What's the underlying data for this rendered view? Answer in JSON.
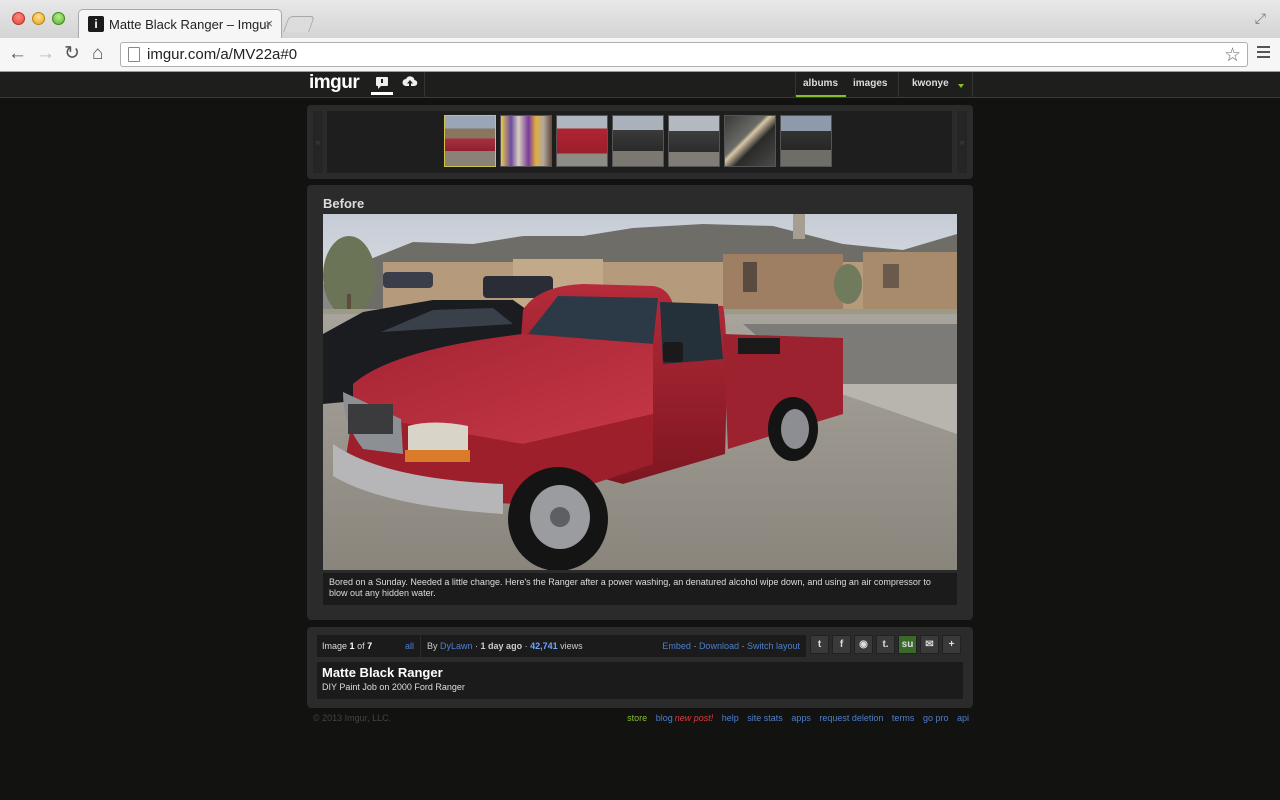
{
  "browser": {
    "tab_title": "Matte Black Ranger – Imgur",
    "tab_close": "×",
    "url": "imgur.com/a/MV22a#0",
    "back": "←",
    "forward": "→",
    "reload": "↻",
    "home": "⌂",
    "star": "☆",
    "fullscreen": "⤢"
  },
  "header": {
    "logo": "imgur",
    "nav": [
      "albums",
      "images"
    ],
    "user": "kwonye",
    "active_nav": "albums",
    "accent_color": "#85bf25"
  },
  "album": {
    "thumbnails": [
      {
        "subject": "red truck in driveway",
        "selected": true
      },
      {
        "subject": "cans of paint and supplies",
        "selected": false
      },
      {
        "subject": "red truck masked",
        "selected": false
      },
      {
        "subject": "black truck front",
        "selected": false
      },
      {
        "subject": "black truck angle",
        "selected": false
      },
      {
        "subject": "black panel close-up",
        "selected": false
      },
      {
        "subject": "black truck finished",
        "selected": false
      }
    ],
    "current_image": {
      "title": "Before",
      "caption": "Bored on a Sunday. Needed a little change. Here's the Ranger after a power washing, an denatured alcohol wipe down, and using an air compressor to blow out any hidden water."
    },
    "counter": {
      "label": "Image",
      "current": "1",
      "of": "of",
      "total": "7",
      "all": "all"
    },
    "meta": {
      "by": "By",
      "author": "DyLawn",
      "time": "1 day ago",
      "views_count": "42,741",
      "views_label": "views",
      "actions": [
        "Embed",
        "Download",
        "Switch layout"
      ]
    },
    "share_icons": [
      "twitter-icon",
      "facebook-icon",
      "reddit-icon",
      "tumblr-icon",
      "stumbleupon-icon",
      "email-icon",
      "plus-icon"
    ],
    "title": "Matte Black Ranger",
    "description": "DIY Paint Job on 2000 Ford Ranger"
  },
  "footer": {
    "copyright": "© 2013 Imgur, LLC.",
    "links": [
      "store",
      "blog",
      "new post!",
      "help",
      "site stats",
      "apps",
      "request deletion",
      "terms",
      "go pro",
      "api"
    ]
  }
}
